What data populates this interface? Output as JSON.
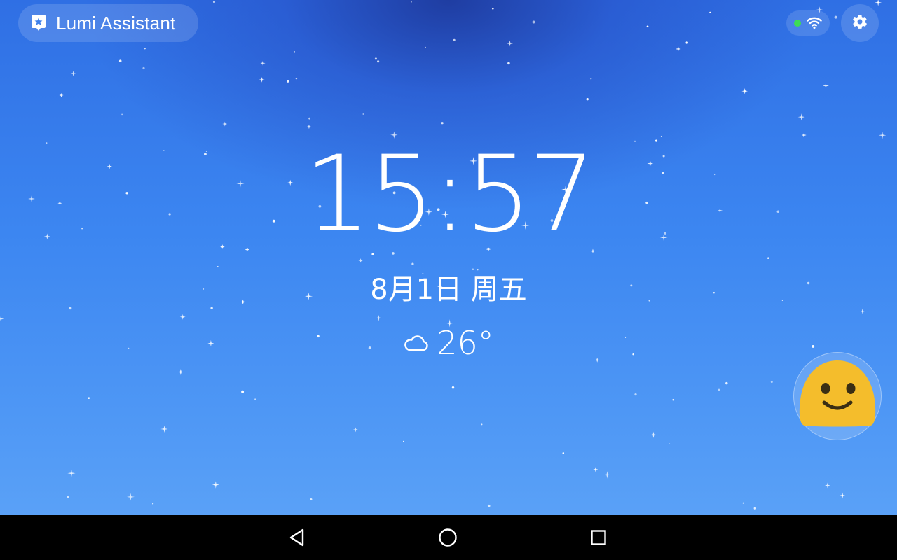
{
  "app": {
    "title": "Lumi Assistant",
    "icon": "assistant-star-icon"
  },
  "status": {
    "connection_dot_color": "#3ddc56",
    "wifi_icon": "wifi-icon",
    "settings_icon": "gear-icon"
  },
  "clock": {
    "time": "15:57"
  },
  "date": {
    "text": "8月1日 周五"
  },
  "weather": {
    "icon": "cloud-icon",
    "temperature": "26°"
  },
  "assistant": {
    "icon": "smiley-face-icon",
    "face_color": "#f4bd2c"
  },
  "navigation": {
    "back_icon": "back-triangle-icon",
    "home_icon": "home-circle-icon",
    "recents_icon": "recents-square-icon"
  },
  "colors": {
    "sky_top": "#2f6fe4",
    "sky_bottom": "#5aa1f7",
    "navbar": "#000000"
  }
}
